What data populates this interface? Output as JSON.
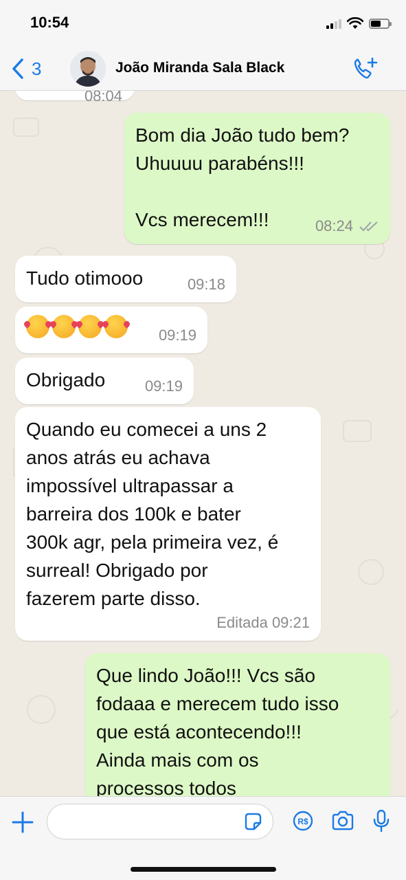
{
  "status_bar": {
    "time": "10:54",
    "icons": [
      "cellular-signal-icon",
      "wifi-icon",
      "battery-icon"
    ]
  },
  "header": {
    "back_count": "3",
    "contact_name": "João Miranda Sala Black",
    "back_icon": "chevron-left-icon",
    "call_icon": "add-call-icon",
    "accent_color": "#1a7ae6"
  },
  "chat": {
    "partial_time": "08:04",
    "messages": [
      {
        "direction": "out",
        "text": "Bom dia João tudo bem?\nUhuuuu parabéns!!!\n\nVcs merecem!!!",
        "time": "08:24",
        "status": "read-checkmarks"
      },
      {
        "direction": "in",
        "text": "Tudo otimooo",
        "time": "09:18"
      },
      {
        "direction": "in",
        "text": "🥰🥰🥰🥰",
        "emoji_name": "smiling-face-with-hearts",
        "emoji_count": 4,
        "time": "09:19"
      },
      {
        "direction": "in",
        "text": "Obrigado",
        "time": "09:19"
      },
      {
        "direction": "in",
        "text": "Quando eu comecei a uns 2\nanos atrás eu achava\nimpossível ultrapassar a\nbarreira dos 100k e bater\n300k agr, pela primeira vez, é\nsurreal! Obrigado por\nfazerem parte disso.",
        "time": "Editada 09:21"
      },
      {
        "direction": "out",
        "text": "Que lindo João!!! Vcs são\nfodaaa e merecem tudo isso\nque está acontecendo!!!\nAinda mais com os\nprocessos todos"
      }
    ],
    "colors": {
      "incoming": "#ffffff",
      "outgoing": "#dcf8c6",
      "background": "#efeae2"
    }
  },
  "input_bar": {
    "placeholder": "",
    "icons": [
      "plus-icon",
      "sticker-icon",
      "pix-icon",
      "camera-icon",
      "microphone-icon"
    ]
  }
}
